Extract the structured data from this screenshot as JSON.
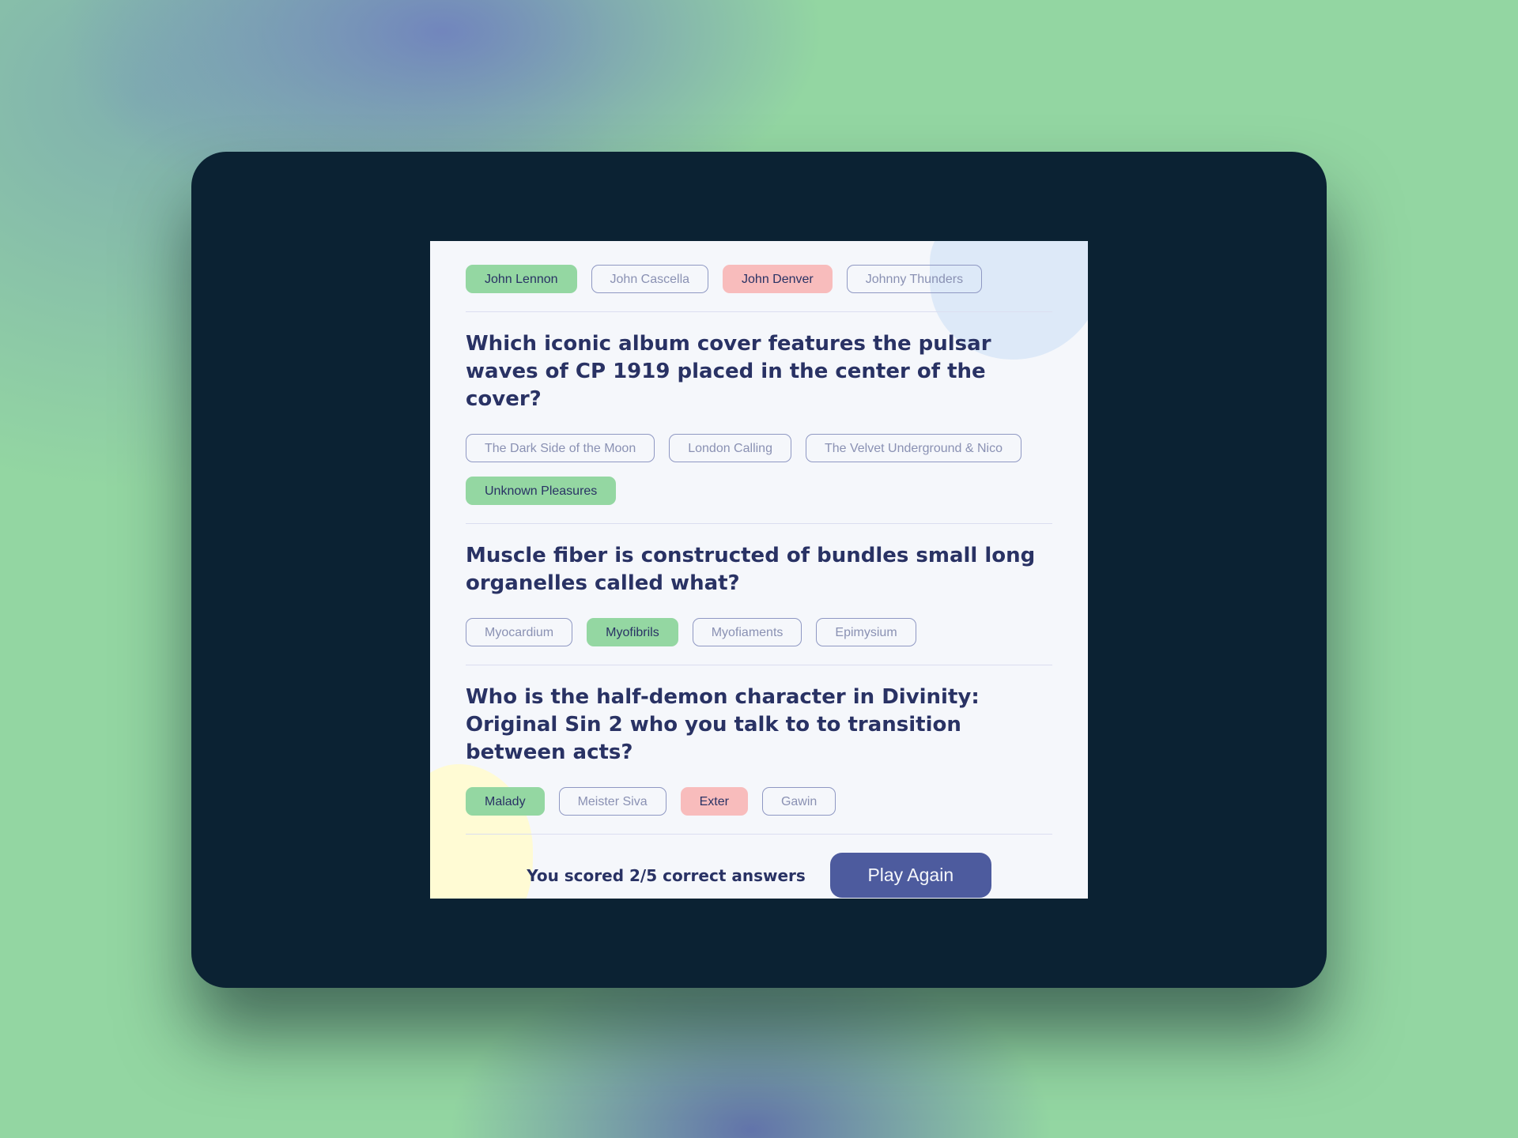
{
  "quiz": {
    "questions": [
      {
        "text": "",
        "answers": [
          {
            "label": "John Lennon",
            "state": "correct"
          },
          {
            "label": "John Cascella",
            "state": "neutral"
          },
          {
            "label": "John Denver",
            "state": "wrong"
          },
          {
            "label": "Johnny Thunders",
            "state": "neutral"
          }
        ]
      },
      {
        "text": "Which iconic album cover features the pulsar waves of CP 1919 placed in the center of the cover?",
        "answers": [
          {
            "label": "The Dark Side of the Moon",
            "state": "neutral"
          },
          {
            "label": "London Calling",
            "state": "neutral"
          },
          {
            "label": "The Velvet Underground & Nico",
            "state": "neutral"
          },
          {
            "label": "Unknown Pleasures",
            "state": "correct"
          }
        ]
      },
      {
        "text": "Muscle fiber is constructed of bundles small long organelles called what?",
        "answers": [
          {
            "label": "Myocardium",
            "state": "neutral"
          },
          {
            "label": "Myofibrils",
            "state": "correct"
          },
          {
            "label": "Myofiaments",
            "state": "neutral"
          },
          {
            "label": "Epimysium",
            "state": "neutral"
          }
        ]
      },
      {
        "text": "Who is the half-demon character in Divinity: Original Sin 2 who you talk to to transition between acts?",
        "answers": [
          {
            "label": "Malady",
            "state": "correct"
          },
          {
            "label": "Meister Siva",
            "state": "neutral"
          },
          {
            "label": "Exter",
            "state": "wrong"
          },
          {
            "label": "Gawin",
            "state": "neutral"
          }
        ]
      }
    ]
  },
  "footer": {
    "score_text": "You scored 2/5 correct answers",
    "play_again_label": "Play Again"
  },
  "colors": {
    "correct": "#94d7a2",
    "wrong": "#f8bcbc",
    "primary_text": "#293264",
    "button": "#4d5b9e",
    "card_background": "#f5f7fb"
  }
}
